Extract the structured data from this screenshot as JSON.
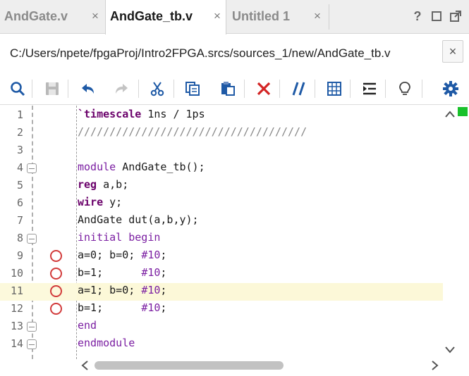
{
  "tabs": [
    {
      "label": "AndGate.v",
      "active": false
    },
    {
      "label": "AndGate_tb.v",
      "active": true
    },
    {
      "label": "Untitled 1",
      "active": false
    }
  ],
  "window_controls": {
    "help": "?",
    "close_tab": "×"
  },
  "path": {
    "text": "C:/Users/npete/fpgaProj/Intro2FPGA.srcs/sources_1/new/AndGate_tb.v"
  },
  "toolbar_icons": [
    "search-icon",
    "save-icon",
    "undo-icon",
    "redo-icon",
    "cut-icon",
    "copy-icon",
    "paste-icon",
    "delete-icon",
    "comment-icon",
    "block-selection-icon",
    "indent-icon",
    "lightbulb-icon",
    "settings-icon"
  ],
  "colors": {
    "accent_green": "#19c12b",
    "breakpoint": "#d23b3b",
    "keyword": "#7b1fa2",
    "highlight_line": "#fcf8d8"
  },
  "editor": {
    "lines": [
      {
        "n": "1",
        "fold": false,
        "bp": false,
        "hl": false
      },
      {
        "n": "2",
        "fold": false,
        "bp": false,
        "hl": false
      },
      {
        "n": "3",
        "fold": false,
        "bp": false,
        "hl": false
      },
      {
        "n": "4",
        "fold": true,
        "bp": false,
        "hl": false
      },
      {
        "n": "5",
        "fold": false,
        "bp": false,
        "hl": false
      },
      {
        "n": "6",
        "fold": false,
        "bp": false,
        "hl": false
      },
      {
        "n": "7",
        "fold": false,
        "bp": false,
        "hl": false
      },
      {
        "n": "8",
        "fold": true,
        "bp": false,
        "hl": false
      },
      {
        "n": "9",
        "fold": false,
        "bp": true,
        "hl": false
      },
      {
        "n": "10",
        "fold": false,
        "bp": true,
        "hl": false
      },
      {
        "n": "11",
        "fold": false,
        "bp": true,
        "hl": true
      },
      {
        "n": "12",
        "fold": false,
        "bp": true,
        "hl": false
      },
      {
        "n": "13",
        "fold": true,
        "bp": false,
        "hl": false
      },
      {
        "n": "14",
        "fold": true,
        "bp": false,
        "hl": false
      }
    ],
    "code": {
      "l1_kw": "`timescale",
      "l1_rest": " 1ns / 1ps",
      "l2": "////////////////////////////////////",
      "l4_kw": "module",
      "l4_rest": " AndGate_tb();",
      "l5_kw": "reg",
      "l5_rest": " a,b;",
      "l6_kw": "wire",
      "l6_rest": " y;",
      "l7": "AndGate dut(a,b,y);",
      "l8_kw1": "initial",
      "l8_kw2": "begin",
      "l9_a": "a=0; b=0; ",
      "l9_d": "#10",
      "l9_e": ";",
      "l10_a": "b=1;      ",
      "l10_d": "#10",
      "l10_e": ";",
      "l11_a": "a=1; b=0; ",
      "l11_d": "#10",
      "l11_e": ";",
      "l12_a": "b=1;      ",
      "l12_d": "#10",
      "l12_e": ";",
      "l13_kw": "end",
      "l14_kw": "endmodule"
    }
  }
}
